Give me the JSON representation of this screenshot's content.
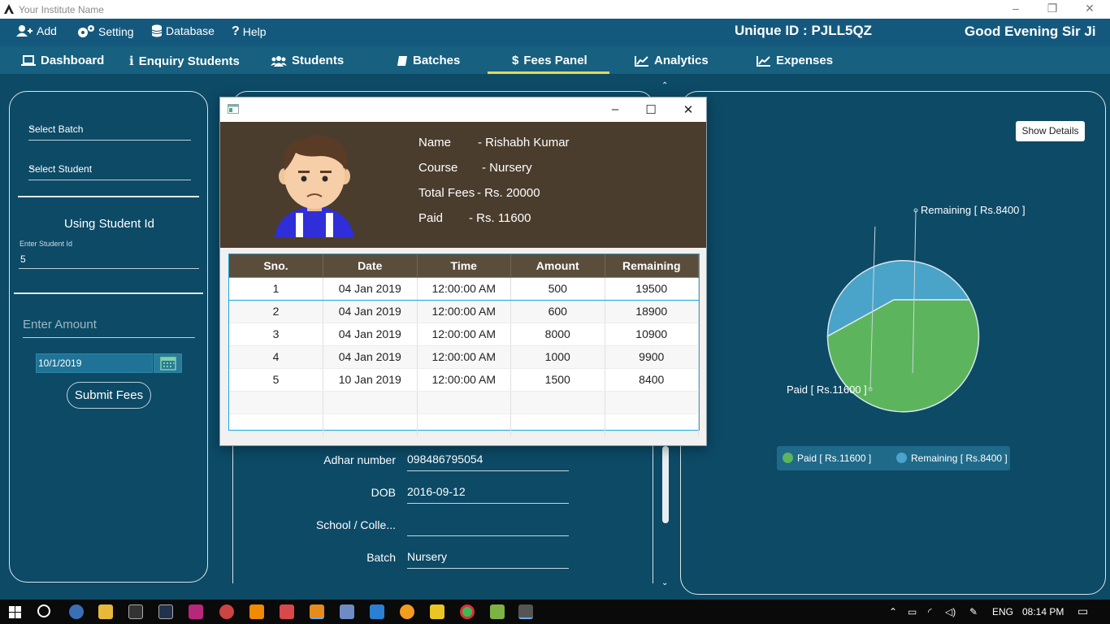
{
  "window": {
    "title": "Your Institute Name"
  },
  "menu": {
    "items": [
      {
        "label": "Add",
        "icon": "add-user-icon"
      },
      {
        "label": "Setting",
        "icon": "gears-icon"
      },
      {
        "label": "Database",
        "icon": "database-icon"
      },
      {
        "label": "Help",
        "icon": "question-icon"
      }
    ],
    "unique_id": "Unique ID : PJLL5QZ",
    "greeting": "Good Evening Sir Ji"
  },
  "tabs": [
    {
      "label": "Dashboard",
      "icon": "laptop-icon"
    },
    {
      "label": "Enquiry Students",
      "icon": "info-icon"
    },
    {
      "label": "Students",
      "icon": "users-icon"
    },
    {
      "label": "Batches",
      "icon": "book-icon"
    },
    {
      "label": "Fees Panel",
      "icon": "dollar-icon",
      "active": true
    },
    {
      "label": "Analytics",
      "icon": "line-chart-icon"
    },
    {
      "label": "Expenses",
      "icon": "area-chart-icon"
    }
  ],
  "left_panel": {
    "select_batch": "Select Batch",
    "select_student": "Select Student",
    "heading": "Using Student Id",
    "id_label": "Enter Student Id",
    "id_value": "5",
    "amount_placeholder": "Enter Amount",
    "date_value": "10/1/2019",
    "submit_label": "Submit Fees"
  },
  "student_form": {
    "rows": [
      {
        "label": "Adhar number",
        "value": "098486795054"
      },
      {
        "label": "DOB",
        "value": "2016-09-12"
      },
      {
        "label": "School / Colle...",
        "value": ""
      },
      {
        "label": "Batch",
        "value": "Nursery"
      }
    ]
  },
  "right_panel": {
    "show_details_label": "Show Details",
    "pie": {
      "slices": [
        {
          "label": "Remaining [ Rs.8400 ]",
          "value": 8400,
          "color": "#4aa3c8"
        },
        {
          "label": "Paid [ Rs.11600 ]",
          "value": 11600,
          "color": "#5cb55c"
        }
      ]
    },
    "legend": [
      {
        "label": "Paid [ Rs.11600 ]",
        "color": "#5cb55c"
      },
      {
        "label": "Remaining [ Rs.8400 ]",
        "color": "#4aa3c8"
      }
    ]
  },
  "dialog": {
    "student": {
      "name_label": "Name",
      "name_value": "- Rishabh Kumar",
      "course_label": "Course",
      "course_value": "- Nursery",
      "fees_label": "Total Fees",
      "fees_value": "- Rs. 20000",
      "paid_label": "Paid",
      "paid_value": "- Rs. 11600"
    },
    "table": {
      "columns": [
        "Sno.",
        "Date",
        "Time",
        "Amount",
        "Remaining"
      ],
      "rows": [
        [
          "1",
          "04 Jan 2019",
          "12:00:00 AM",
          "500",
          "19500"
        ],
        [
          "2",
          "04 Jan 2019",
          "12:00:00 AM",
          "600",
          "18900"
        ],
        [
          "3",
          "04 Jan 2019",
          "12:00:00 AM",
          "8000",
          "10900"
        ],
        [
          "4",
          "04 Jan 2019",
          "12:00:00 AM",
          "1000",
          "9900"
        ],
        [
          "5",
          "10 Jan 2019",
          "12:00:00 AM",
          "1500",
          "8400"
        ]
      ]
    }
  },
  "taskbar": {
    "language": "ENG",
    "time": "08:14 PM"
  }
}
